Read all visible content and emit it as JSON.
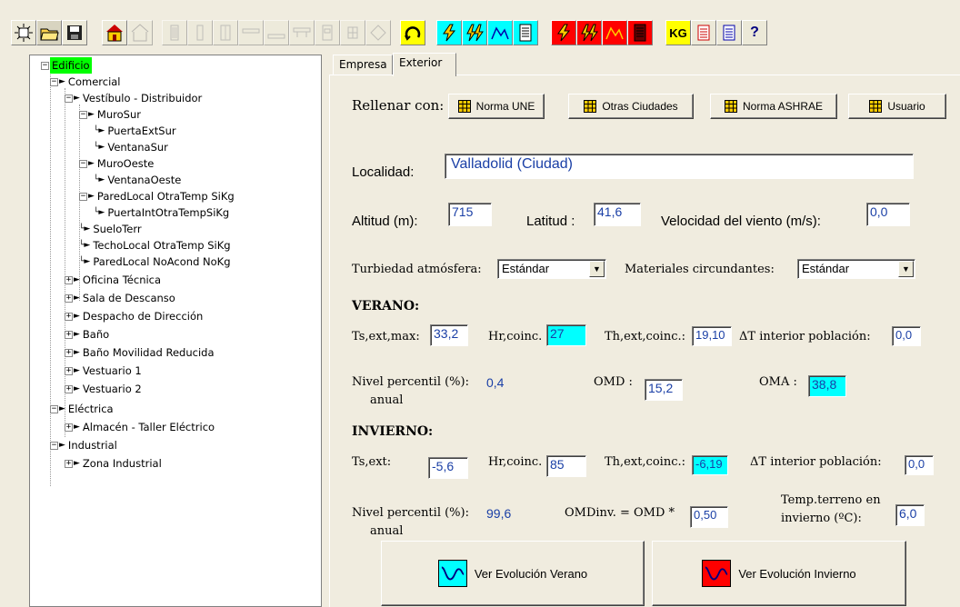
{
  "toolbar": {
    "icons": [
      "new-project-icon",
      "open-folder-icon",
      "save-icon",
      "building-icon",
      "building-outline-icon",
      "wall-icon",
      "wall2-icon",
      "wall3-icon",
      "roof-icon",
      "floor-icon",
      "door-icon",
      "window-icon",
      "diamond-icon",
      "refresh-icon",
      "summer-load-icon",
      "summer-load2-icon",
      "summer-chart-icon",
      "summer-report-icon",
      "winter-load-icon",
      "winter-load2-icon",
      "winter-chart-icon",
      "winter-report-icon",
      "kg-icon",
      "list-icon",
      "list2-icon",
      "help-icon"
    ],
    "kg_label": "KG",
    "help_label": "?",
    "colors": {
      "summer": "#00ffff",
      "winter": "#ff0000",
      "building": "#ffcc00"
    }
  },
  "tree": {
    "root": "Edificio",
    "nodes": [
      "Comercial",
      "Vestíbulo - Distribuidor",
      "MuroSur",
      "PuertaExtSur",
      "VentanaSur",
      "MuroOeste",
      "VentanaOeste",
      "ParedLocal OtraTemp SiKg",
      "PuertaIntOtraTempSiKg",
      "SueloTerr",
      "TechoLocal OtraTemp SiKg",
      "ParedLocal NoAcond NoKg",
      "Oficina Técnica",
      "Sala de Descanso",
      "Despacho de Dirección",
      "Baño",
      "Baño Movilidad Reducida",
      "Vestuario 1",
      "Vestuario 2",
      "Eléctrica",
      "Almacén - Taller Eléctrico",
      "Industrial",
      "Zona Industrial"
    ]
  },
  "tabs": [
    "Empresa",
    "Exterior"
  ],
  "fill": {
    "label": "Rellenar con:",
    "buttons": [
      "Norma UNE",
      "Otras Ciudades",
      "Norma ASHRAE",
      "Usuario"
    ]
  },
  "location": {
    "label": "Localidad:",
    "value": "Valladolid (Ciudad)"
  },
  "altitude": {
    "label": "Altitud (m):",
    "value": "715"
  },
  "latitude": {
    "label": "Latitud :",
    "value": "41,6"
  },
  "wind": {
    "label": "Velocidad del viento (m/s):",
    "value": "0,0"
  },
  "turbidity": {
    "label": "Turbiedad atmósfera:",
    "value": "Estándar"
  },
  "materials": {
    "label": "Materiales circundantes:",
    "value": "Estándar"
  },
  "summer": {
    "title": "VERANO:",
    "ts_label": "Ts,ext,max:",
    "ts_value": "33,2",
    "hr_label": "Hr,coinc.",
    "hr_value": "27",
    "th_label": "Th,ext,coinc.:",
    "th_value": "19,10",
    "dt_label": "ΔT interior población:",
    "dt_value": "0,0",
    "percentile_label": "Nivel percentil (%):",
    "percentile_sub": "anual",
    "percentile_value": "0,4",
    "omd_label": "OMD :",
    "omd_value": "15,2",
    "oma_label": "OMA :",
    "oma_value": "38,8"
  },
  "winter": {
    "title": "INVIERNO:",
    "ts_label": "Ts,ext:",
    "ts_value": "-5,6",
    "hr_label": "Hr,coinc.",
    "hr_value": "85",
    "th_label": "Th,ext,coinc.:",
    "th_value": "-6,19",
    "dt_label": "ΔT interior población:",
    "dt_value": "0,0",
    "percentile_label": "Nivel percentil (%):",
    "percentile_sub": "anual",
    "percentile_value": "99,6",
    "omd_label": "OMDinv. = OMD *",
    "omd_value": "0,50",
    "ground_label_1": "Temp.terreno  en",
    "ground_label_2": "invierno  (ºC):",
    "ground_value": "6,0"
  },
  "evolution": {
    "summer_label": "Ver Evolución Verano",
    "winter_label": "Ver Evolución Invierno"
  }
}
